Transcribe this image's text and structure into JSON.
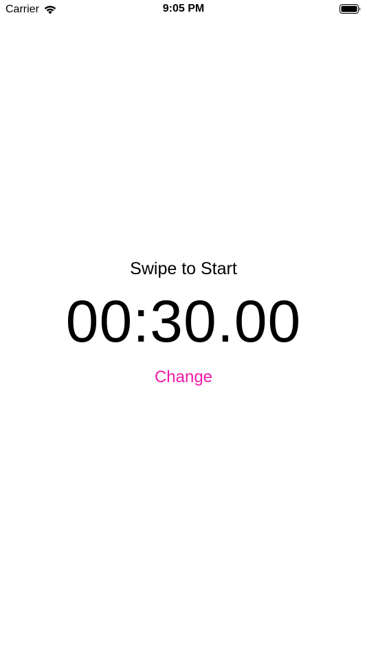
{
  "status_bar": {
    "carrier": "Carrier",
    "time": "9:05 PM",
    "wifi_icon": "wifi-icon",
    "battery_icon": "battery-icon"
  },
  "main": {
    "instruction": "Swipe to Start",
    "timer_value": "00:30.00",
    "change_label": "Change"
  },
  "colors": {
    "accent": "#f01aa7",
    "text": "#000000",
    "background": "#ffffff"
  }
}
